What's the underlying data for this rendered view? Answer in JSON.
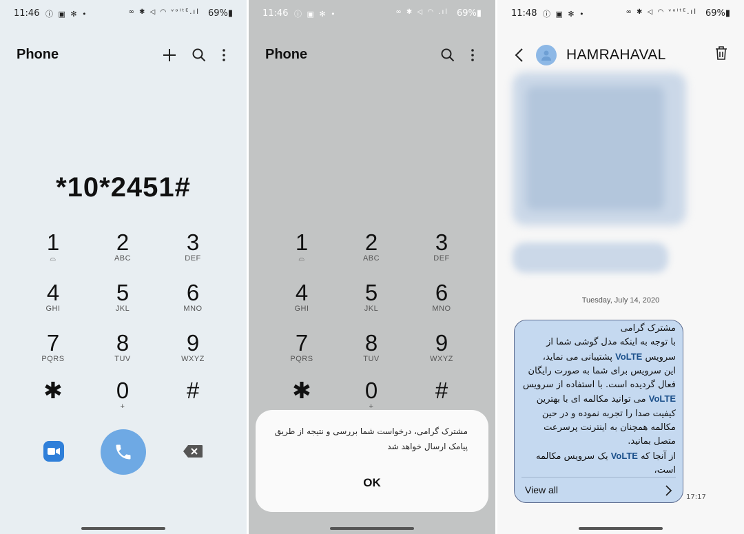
{
  "panel1": {
    "status": {
      "time": "11:46",
      "left_icons": "ⓘ ▣ ✻ •",
      "right_icons": "∞ ✱ ◁ ◠ ᵛᵒˡᵗᴱ.ıl",
      "battery": "69%▮"
    },
    "title": "Phone",
    "number": "*10*2451#",
    "keys": [
      {
        "digit": "1",
        "letters": "⌓"
      },
      {
        "digit": "2",
        "letters": "ABC"
      },
      {
        "digit": "3",
        "letters": "DEF"
      },
      {
        "digit": "4",
        "letters": "GHI"
      },
      {
        "digit": "5",
        "letters": "JKL"
      },
      {
        "digit": "6",
        "letters": "MNO"
      },
      {
        "digit": "7",
        "letters": "PQRS"
      },
      {
        "digit": "8",
        "letters": "TUV"
      },
      {
        "digit": "9",
        "letters": "WXYZ"
      },
      {
        "digit": "✱",
        "letters": ""
      },
      {
        "digit": "0",
        "letters": "+"
      },
      {
        "digit": "#",
        "letters": ""
      }
    ]
  },
  "panel2": {
    "status": {
      "time": "11:46",
      "left_icons": "ⓘ ▣ ✻ •",
      "right_icons": "∞ ✱ ◁ ◠ .ıl",
      "battery": "69%▮"
    },
    "title": "Phone",
    "dialog": {
      "message": "مشترک گرامی، درخواست شما بررسی و نتیجه از طریق پیامک ارسال خواهد شد",
      "ok": "OK"
    }
  },
  "panel3": {
    "status": {
      "time": "11:48",
      "left_icons": "ⓘ ▣ ✻ •",
      "right_icons": "∞ ✱ ◁ ◠ ᵛᵒˡᵗᴱ.ıl",
      "battery": "69%▮"
    },
    "contact": "HAMRAHAVAL",
    "date": "Tuesday, July 14, 2020",
    "message": {
      "l1": "مشترک گرامی",
      "l2": "با توجه به اینکه مدل گوشی شما از",
      "l3a": "سرویس ",
      "l3v": "VoLTE",
      "l3b": " پشتیبانی می نماید،",
      "l4": "این سرویس برای شما به صورت رایگان",
      "l5": "فعال گردیده است. با استفاده از سرویس",
      "l6v": "VoLTE",
      "l6b": " می توانید مکالمه ای با بهترین",
      "l7": "کیفیت صدا را تجربه نموده و در حین",
      "l8": "مکالمه همچنان به اینترنت پرسرعت",
      "l9": "متصل بمانید.",
      "l10a": "از آنجا که ",
      "l10v": "VoLTE",
      "l10b": " یک سرویس مکالمه",
      "l11": "است،"
    },
    "view_all": "View all",
    "time": "17:17"
  }
}
